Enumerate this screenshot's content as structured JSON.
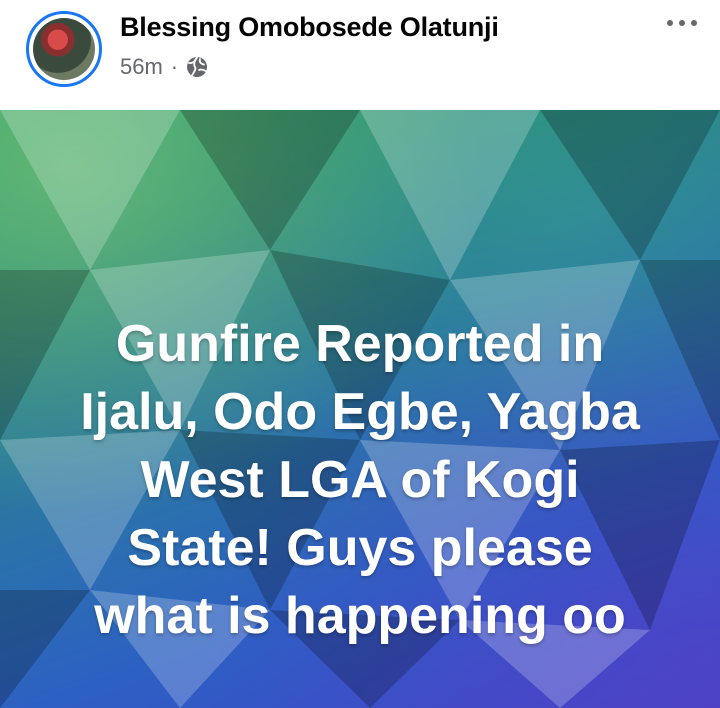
{
  "post": {
    "author": "Blessing Omobosede Olatunji",
    "time": "56m",
    "separator": "·",
    "visibility_icon": "globe-icon",
    "more_icon": "more-options-icon",
    "text_lines": [
      "Gunfire Reported in",
      "Ijalu, Odo Egbe, Yagba",
      "West LGA of Kogi",
      "State! Guys please",
      "what is happening oo"
    ]
  },
  "colors": {
    "story_ring": "#1877f2",
    "author_text": "#050505",
    "meta_text": "#65676b",
    "gradient_start": "#2d9b6c",
    "gradient_end": "#4646c6"
  }
}
